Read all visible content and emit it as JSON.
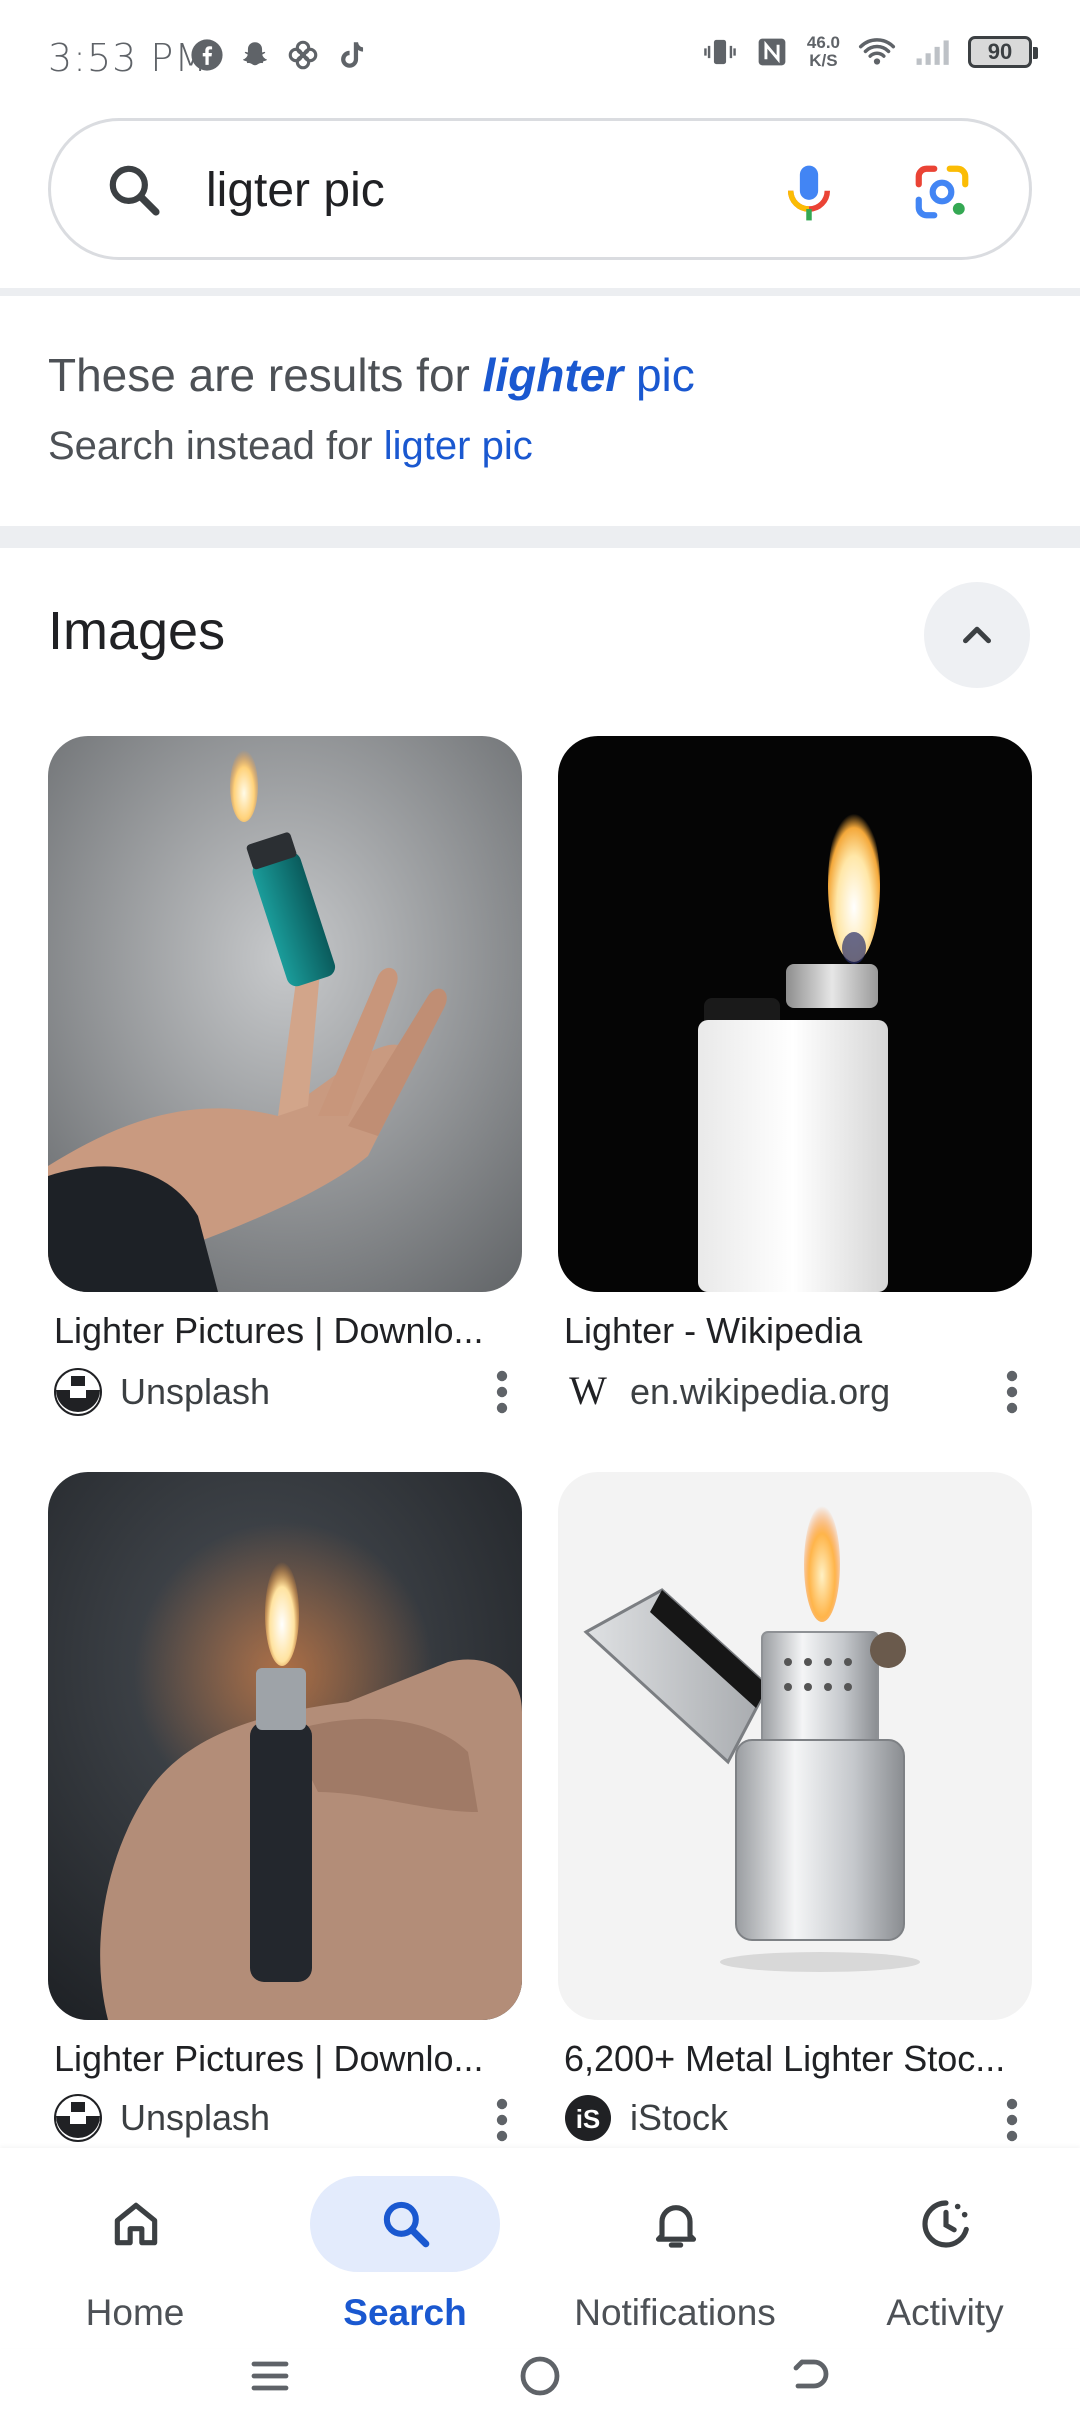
{
  "status_bar": {
    "time": "3:53 PM",
    "net_speed_value": "46.0",
    "net_speed_unit": "K/S",
    "battery": "90"
  },
  "search": {
    "query": "ligter pic"
  },
  "spelling": {
    "prefix": "These are results for",
    "corrected_bold": "lighter",
    "corrected_rest": "pic",
    "instead_prefix": "Search instead for",
    "original_query": "ligter pic"
  },
  "images_section": {
    "title": "Images",
    "results": [
      {
        "title": "Lighter Pictures | Downlo...",
        "source": "Unsplash"
      },
      {
        "title": "Lighter - Wikipedia",
        "source": "en.wikipedia.org"
      },
      {
        "title": "Lighter Pictures | Downlo...",
        "source": "Unsplash"
      },
      {
        "title": "6,200+ Metal Lighter Stoc...",
        "source": "iStock"
      }
    ]
  },
  "bottom_nav": {
    "items": [
      {
        "label": "Home",
        "icon": "home-icon"
      },
      {
        "label": "Search",
        "icon": "search-icon",
        "active": true
      },
      {
        "label": "Notifications",
        "icon": "bell-icon"
      },
      {
        "label": "Activity",
        "icon": "activity-icon"
      }
    ]
  },
  "colors": {
    "link_blue": "#1a58d0",
    "active_pill": "#e3ebfc",
    "divider": "#eceef1"
  }
}
